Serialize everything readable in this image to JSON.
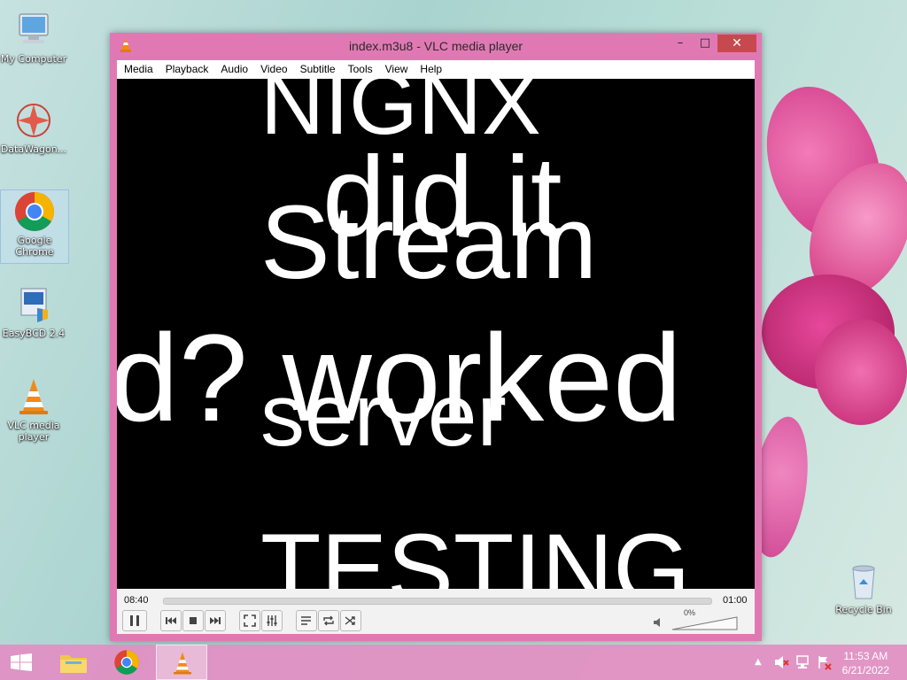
{
  "desktop": {
    "icons": [
      {
        "label": "My Computer",
        "icon": "computer-icon"
      },
      {
        "label": "DataWagon...",
        "icon": "datawagon-icon"
      },
      {
        "label": "Google Chrome",
        "icon": "chrome-icon"
      },
      {
        "label": "EasyBCD 2.4",
        "icon": "easybcd-icon"
      },
      {
        "label": "VLC media player",
        "icon": "vlc-cone-icon"
      },
      {
        "label": "Recycle Bin",
        "icon": "recycle-bin-icon"
      }
    ]
  },
  "window": {
    "title": "index.m3u8 - VLC media player",
    "menu": [
      "Media",
      "Playback",
      "Audio",
      "Video",
      "Subtitle",
      "Tools",
      "View",
      "Help"
    ]
  },
  "video": {
    "overlay_texts": [
      "NIGNX",
      "did it",
      "Stream",
      "d? worked",
      "server",
      "TESTING"
    ]
  },
  "controls": {
    "elapsed": "08:40",
    "remaining": "01:00",
    "volume": "0%"
  },
  "taskbar": {
    "time": "11:53 AM",
    "date": "6/21/2022"
  },
  "colors": {
    "window_frame": "#e079b3",
    "close_button": "#c7494f",
    "taskbar": "#e28ec2",
    "vlc_orange": "#f08a1c"
  }
}
